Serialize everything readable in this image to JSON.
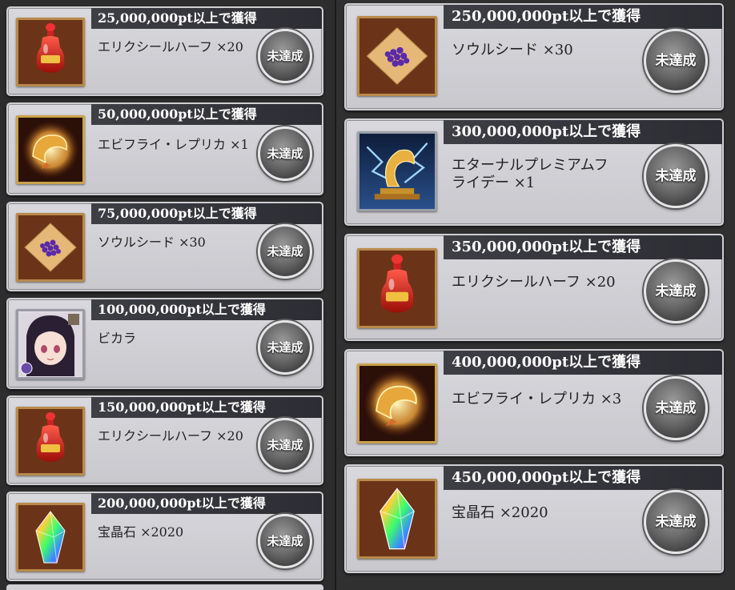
{
  "status_label": "未達成",
  "left_rewards": [
    {
      "header": "25,000,000pt以上で獲得",
      "item": "エリクシールハーフ ×20",
      "icon": "elixir-half-icon"
    },
    {
      "header": "50,000,000pt以上で獲得",
      "item": "エビフライ・レプリカ ×1",
      "icon": "fried-shrimp-replica-icon"
    },
    {
      "header": "75,000,000pt以上で獲得",
      "item": "ソウルシード ×30",
      "icon": "soul-seed-icon"
    },
    {
      "header": "100,000,000pt以上で獲得",
      "item": "ビカラ",
      "icon": "vikala-portrait-icon"
    },
    {
      "header": "150,000,000pt以上で獲得",
      "item": "エリクシールハーフ ×20",
      "icon": "elixir-half-icon"
    },
    {
      "header": "200,000,000pt以上で獲得",
      "item": "宝晶石 ×2020",
      "icon": "crystal-icon"
    }
  ],
  "right_rewards": [
    {
      "header": "250,000,000pt以上で獲得",
      "item": "ソウルシード ×30",
      "icon": "soul-seed-icon"
    },
    {
      "header": "300,000,000pt以上で獲得",
      "item_line1": "エターナルプレミアムフ",
      "item_line2": "ライデー ×1",
      "icon": "eternal-premium-friday-icon"
    },
    {
      "header": "350,000,000pt以上で獲得",
      "item": "エリクシールハーフ ×20",
      "icon": "elixir-half-icon"
    },
    {
      "header": "400,000,000pt以上で獲得",
      "item": "エビフライ・レプリカ ×3",
      "icon": "fried-shrimp-replica-icon"
    },
    {
      "header": "450,000,000pt以上で獲得",
      "item": "宝晶石 ×2020",
      "icon": "crystal-icon"
    }
  ]
}
